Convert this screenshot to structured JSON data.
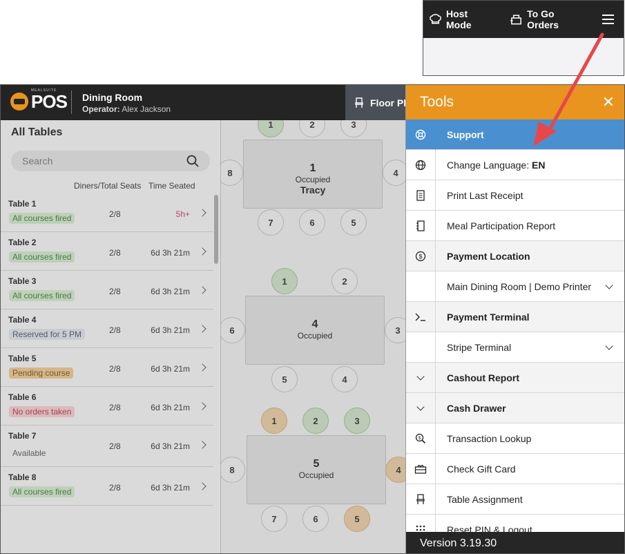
{
  "inset": {
    "host_mode": "Host Mode",
    "to_go_orders": "To Go Orders"
  },
  "topbar": {
    "brand_small": "MEALSUITE",
    "brand": "POS",
    "room_title": "Dining Room",
    "operator_label": "Operator:",
    "operator_name": "Alex Jackson",
    "floor_tab": "Floor Pla"
  },
  "tables_panel": {
    "title": "All Tables",
    "search_placeholder": "Search",
    "col_diners": "Diners/Total Seats",
    "col_time": "Time Seated",
    "rows": [
      {
        "name": "Table 1",
        "status": "All courses fired",
        "seats": "2/8",
        "time": "5h+"
      },
      {
        "name": "Table 2",
        "status": "All courses fired",
        "seats": "2/8",
        "time": "6d 3h 21m"
      },
      {
        "name": "Table 3",
        "status": "All courses fired",
        "seats": "2/8",
        "time": "6d 3h 21m"
      },
      {
        "name": "Table 4",
        "status": "Reserved for 5 PM",
        "seats": "2/8",
        "time": "6d 3h 21m"
      },
      {
        "name": "Table 5",
        "status": "Pending course",
        "seats": "2/8",
        "time": "6d 3h 21m"
      },
      {
        "name": "Table 6",
        "status": "No orders taken",
        "seats": "2/8",
        "time": "6d 3h 21m"
      },
      {
        "name": "Table 7",
        "status": "Available",
        "seats": "2/8",
        "time": "6d 3h 21m"
      },
      {
        "name": "Table 8",
        "status": "All courses fired",
        "seats": "2/8",
        "time": "6d 3h 21m"
      }
    ]
  },
  "floor": {
    "t1": {
      "num": "1",
      "status": "Occupied",
      "name": "Tracy"
    },
    "t4": {
      "num": "4",
      "status": "Occupied"
    },
    "t5": {
      "num": "5",
      "status": "Occupied"
    },
    "s": {
      "1": "1",
      "2": "2",
      "3": "3",
      "4": "4",
      "5": "5",
      "6": "6",
      "7": "7",
      "8": "8"
    }
  },
  "tools": {
    "title": "Tools",
    "support": "Support",
    "change_language": "Change Language: ",
    "language": "EN",
    "print_last_receipt": "Print Last Receipt",
    "meal_participation_report": "Meal Participation Report",
    "payment_location": "Payment Location",
    "payment_location_value": "Main Dining Room | Demo Printer",
    "payment_terminal": "Payment Terminal",
    "payment_terminal_value": "Stripe Terminal",
    "cashout_report": "Cashout Report",
    "cash_drawer": "Cash Drawer",
    "transaction_lookup": "Transaction Lookup",
    "check_gift_card": "Check Gift Card",
    "table_assignment": "Table Assignment",
    "reset_pin_logout": "Reset PIN & Logout",
    "version": "Version 3.19.30"
  },
  "colors": {
    "orange": "#e8941f",
    "blue": "#4a8fd0",
    "dark": "#242424",
    "arrow": "#e8474a"
  }
}
